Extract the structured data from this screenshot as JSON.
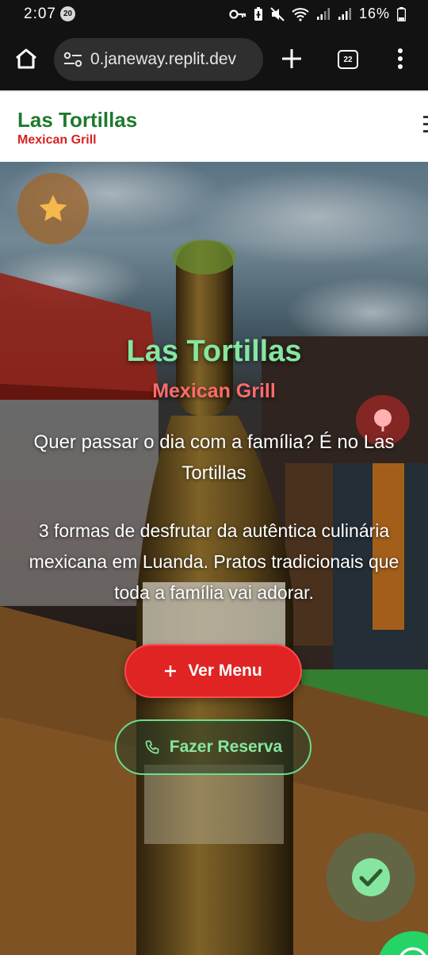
{
  "status_bar": {
    "time": "2:07",
    "notification_badge": "20",
    "battery": "16%"
  },
  "browser": {
    "url": "0.janeway.replit.dev",
    "tab_count": "22"
  },
  "header": {
    "title": "Las Tortillas",
    "subtitle": "Mexican Grill"
  },
  "hero": {
    "title": "Las Tortillas",
    "subtitle": "Mexican Grill",
    "lead": "Quer passar o dia com a família? É no Las Tortillas",
    "description": "3 formas de desfrutar da autêntica culinária mexicana em Luanda. Pratos tradicionais que toda a família vai adorar.",
    "menu_button": "Ver Menu",
    "reserve_button": "Fazer Reserva"
  },
  "colors": {
    "brand_green": "#1e7a2d",
    "brand_red": "#d92121",
    "accent_green": "#86e6a0",
    "button_red": "#e02424"
  }
}
